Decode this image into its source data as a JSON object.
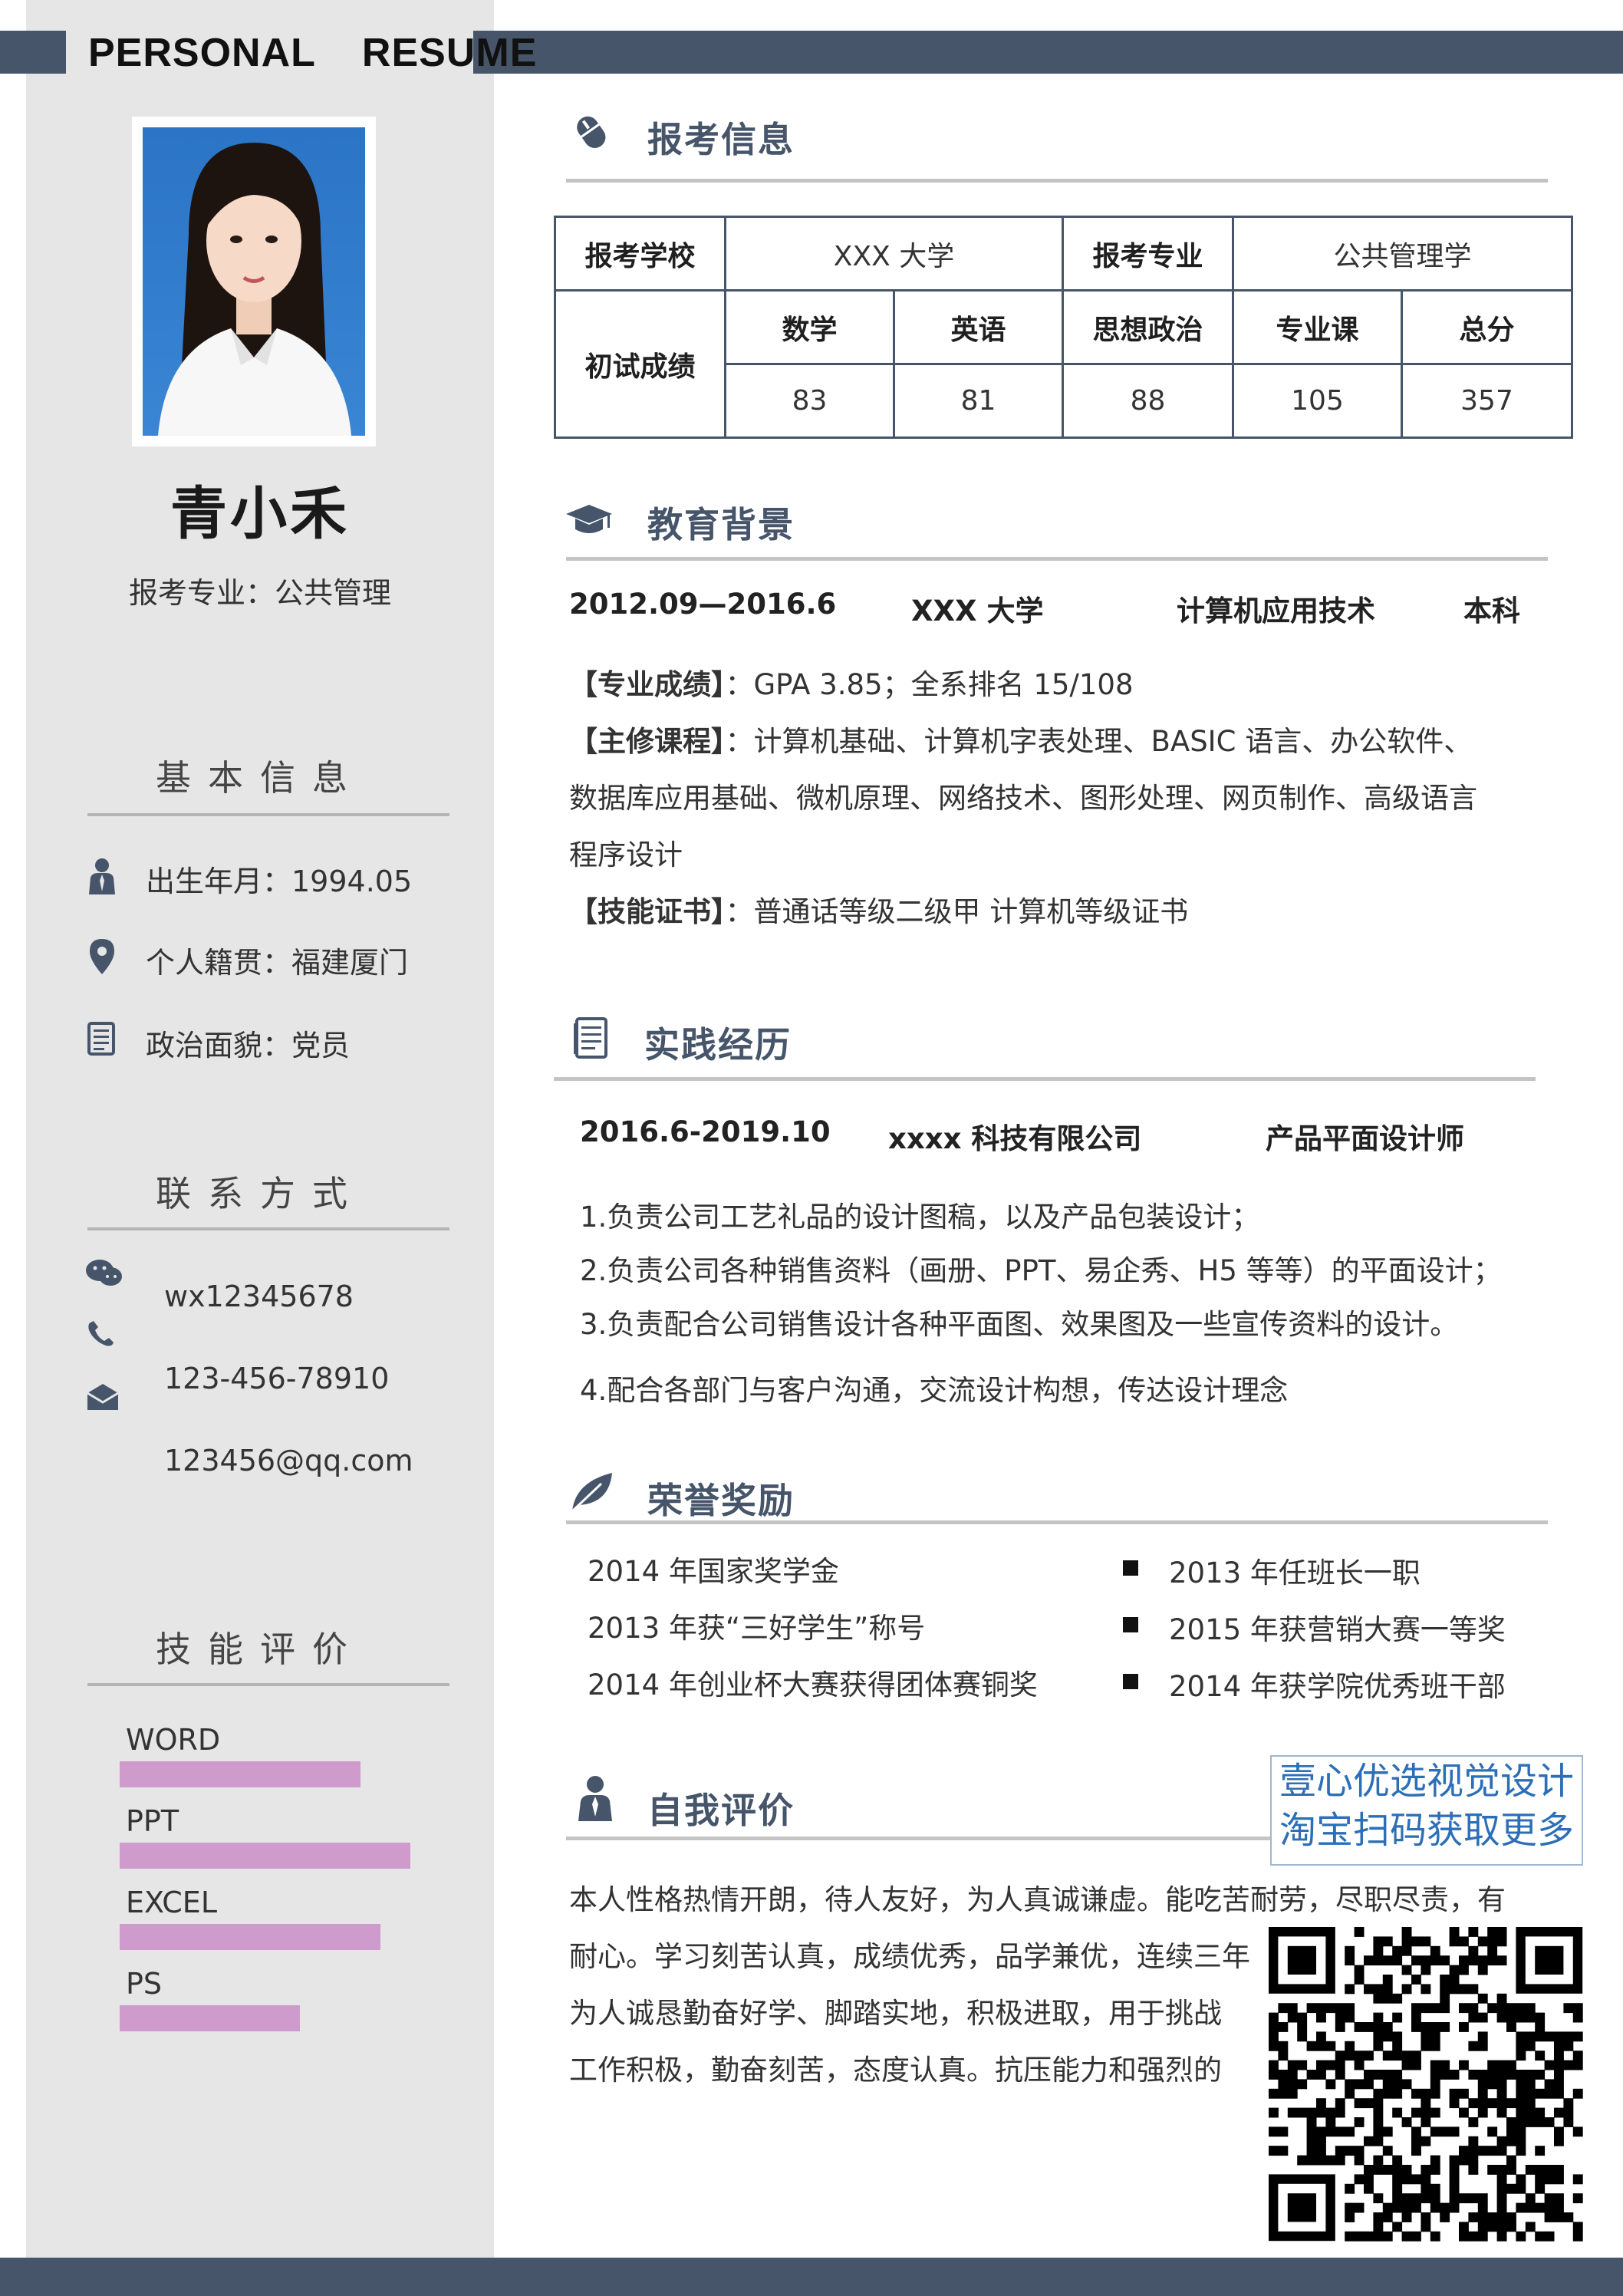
{
  "header": {
    "word1": "PERSONAL",
    "word2": "RESUME"
  },
  "profile": {
    "name": "青小禾",
    "target": "报考专业：公共管理"
  },
  "basic_info": {
    "title": "基本信息",
    "birth": "出生年月：1994.05",
    "hometown": "个人籍贯：福建厦门",
    "politics": "政治面貌：党员"
  },
  "contact": {
    "title": "联系方式",
    "wechat": "wx12345678",
    "phone": "123-456-78910",
    "email": "123456@qq.com"
  },
  "skills": {
    "title": "技能评价",
    "items": [
      {
        "label": "WORD",
        "level": 0.72
      },
      {
        "label": "PPT",
        "level": 0.87
      },
      {
        "label": "EXCEL",
        "level": 0.78
      },
      {
        "label": "PS",
        "level": 0.54
      }
    ]
  },
  "exam": {
    "title": "报考信息",
    "school_label": "报考学校",
    "school": "XXX 大学",
    "major_label": "报考专业",
    "major": "公共管理学",
    "score_label": "初试成绩",
    "subjects": [
      "数学",
      "英语",
      "思想政治",
      "专业课",
      "总分"
    ],
    "scores": [
      "83",
      "81",
      "88",
      "105",
      "357"
    ]
  },
  "education": {
    "title": "教育背景",
    "period": "2012.09—2016.6",
    "school": "XXX 大学",
    "major": "计算机应用技术",
    "degree": "本科",
    "gpa_label": "【专业成绩】",
    "gpa": "：GPA 3.85；全系排名 15/108",
    "courses_label": "【主修课程】",
    "courses_1": "：计算机基础、计算机字表处理、BASIC 语言、办公软件、",
    "courses_2": "数据库应用基础、微机原理、网络技术、图形处理、网页制作、高级语言",
    "courses_3": "程序设计",
    "cert_label": "【技能证书】",
    "cert": "：普通话等级二级甲  计算机等级证书"
  },
  "practice": {
    "title": "实践经历",
    "period": "2016.6-2019.10",
    "company": "xxxx 科技有限公司",
    "position": "产品平面设计师",
    "duties": [
      "1.负责公司工艺礼品的设计图稿，以及产品包装设计；",
      "2.负责公司各种销售资料（画册、PPT、易企秀、H5 等等）的平面设计；",
      "3.负责配合公司销售设计各种平面图、效果图及一些宣传资料的设计。",
      "4.配合各部门与客户沟通，交流设计构想，传达设计理念"
    ]
  },
  "honors": {
    "title": "荣誉奖励",
    "left": [
      "2014 年国家奖学金",
      "2013 年获“三好学生”称号",
      "2014 年创业杯大赛获得团体赛铜奖"
    ],
    "right": [
      "2013 年任班长一职",
      "2015 年获营销大赛一等奖",
      "2014 年获学院优秀班干部"
    ]
  },
  "self_eval": {
    "title": "自我评价",
    "lines": [
      "本人性格热情开朗，待人友好，为人真诚谦虚。能吃苦耐劳，尽职尽责，有",
      "耐心。学习刻苦认真，成绩优秀，品学兼优，连续三年",
      "为人诚恳勤奋好学、脚踏实地，积极进取，用于挑战",
      "工作积极，勤奋刻苦，态度认真。抗压能力和强烈的"
    ]
  },
  "watermark": {
    "line1": "壹心优选视觉设计",
    "line2": "淘宝扫码获取更多"
  },
  "colors": {
    "navy": "#46556a",
    "sidebar": "#e6e6e6",
    "skill_bar": "#cf9bcd",
    "watermark_text": "#2d6fb7"
  },
  "icons": [
    "mouse-icon",
    "graduation-cap-icon",
    "document-icon",
    "leaf-icon",
    "user-icon",
    "person-icon",
    "location-pin-icon",
    "wechat-icon",
    "phone-icon",
    "mail-icon"
  ]
}
